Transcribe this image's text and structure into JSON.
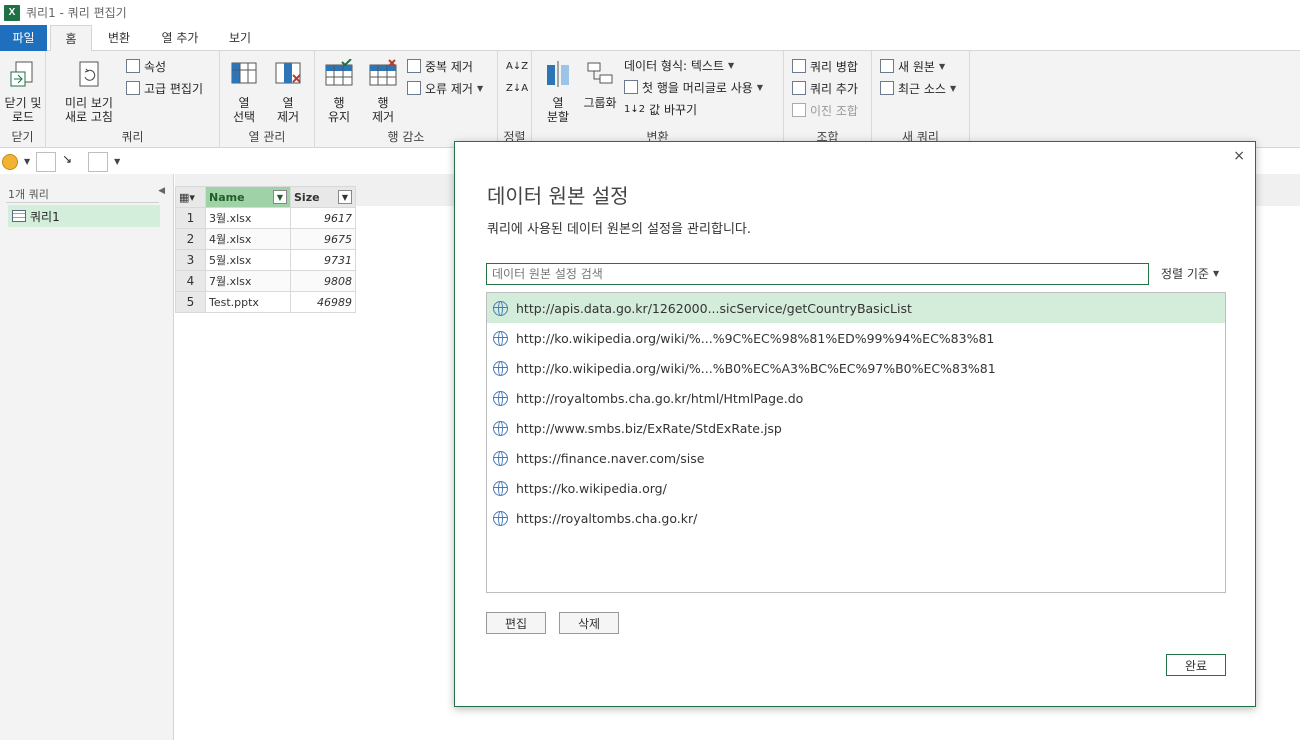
{
  "window": {
    "title": "쿼리1 - 쿼리 편집기",
    "app_logo": "X"
  },
  "tabs": [
    "파일",
    "홈",
    "변환",
    "열 추가",
    "보기"
  ],
  "ribbon": {
    "close_group": {
      "button": "닫기 및\n로드",
      "label": "닫기"
    },
    "query_group": {
      "preview": "미리 보기\n새로 고침",
      "properties": "속성",
      "advanced": "고급 편집기",
      "label": "쿼리"
    },
    "columns_group": {
      "select": "열\n선택",
      "remove": "열\n제거",
      "label": "열 관리"
    },
    "rows_group": {
      "keep": "행\n유지",
      "remove": "행\n제거",
      "dedupe": "중복 제거",
      "errors": "오류 제거",
      "label": "행 감소"
    },
    "sort_group": {
      "label": "정렬"
    },
    "transform_group": {
      "split": "열\n분할",
      "group": "그룹화",
      "datatype": "데이터 형식: 텍스트",
      "firstrow": "첫 행을 머리글로 사용",
      "replace": "값 바꾸기",
      "label": "변환"
    },
    "combine_group": {
      "merge": "쿼리 병합",
      "append": "쿼리 추가",
      "binary": "이진 조합",
      "label": "조합"
    },
    "newquery_group": {
      "new": "새 원본",
      "recent": "최근 소스",
      "label": "새 쿼리"
    }
  },
  "query_pane": {
    "header": "1개 쿼리",
    "items": [
      "쿼리1"
    ]
  },
  "grid": {
    "columns": [
      "Name",
      "Size"
    ],
    "rows": [
      {
        "n": "1",
        "name": "3월.xlsx",
        "size": "9617"
      },
      {
        "n": "2",
        "name": "4월.xlsx",
        "size": "9675"
      },
      {
        "n": "3",
        "name": "5월.xlsx",
        "size": "9731"
      },
      {
        "n": "4",
        "name": "7월.xlsx",
        "size": "9808"
      },
      {
        "n": "5",
        "name": "Test.pptx",
        "size": "46989"
      }
    ]
  },
  "dialog": {
    "title": "데이터 원본 설정",
    "description": "쿼리에 사용된 데이터 원본의 설정을 관리합니다.",
    "search_placeholder": "데이터 원본 설정 검색",
    "sort_label": "정렬 기준",
    "sources": [
      "http://apis.data.go.kr/1262000...sicService/getCountryBasicList",
      "http://ko.wikipedia.org/wiki/%...%9C%EC%98%81%ED%99%94%EC%83%81",
      "http://ko.wikipedia.org/wiki/%...%B0%EC%A3%BC%EC%97%B0%EC%83%81",
      "http://royaltombs.cha.go.kr/html/HtmlPage.do",
      "http://www.smbs.biz/ExRate/StdExRate.jsp",
      "https://finance.naver.com/sise",
      "https://ko.wikipedia.org/",
      "https://royaltombs.cha.go.kr/"
    ],
    "selected_index": 0,
    "buttons": {
      "edit": "편집",
      "delete": "삭제",
      "done": "완료"
    },
    "close": "×"
  },
  "colors": {
    "accent": "#217346",
    "file_tab": "#1f6fbf",
    "selected": "#d4ecda"
  }
}
